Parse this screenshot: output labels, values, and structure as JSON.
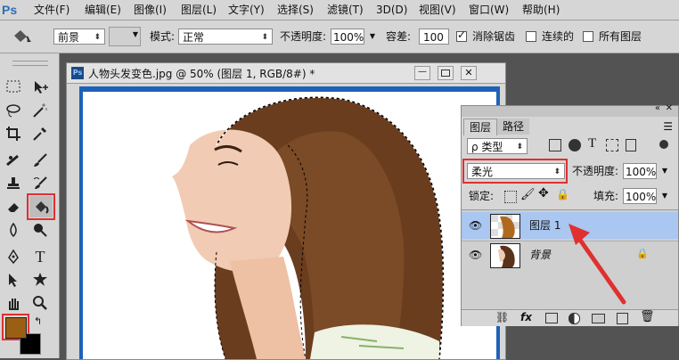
{
  "app": {
    "logo": "Ps"
  },
  "menu": [
    "文件(F)",
    "编辑(E)",
    "图像(I)",
    "图层(L)",
    "文字(Y)",
    "选择(S)",
    "滤镜(T)",
    "3D(D)",
    "视图(V)",
    "窗口(W)",
    "帮助(H)"
  ],
  "options": {
    "fill_source": "前景",
    "mode_label": "模式:",
    "mode_value": "正常",
    "opacity_label": "不透明度:",
    "opacity_value": "100%",
    "tolerance_label": "容差:",
    "tolerance_value": "100",
    "antialias_label": "消除锯齿",
    "antialias_checked": true,
    "contiguous_label": "连续的",
    "contiguous_checked": false,
    "all_layers_label": "所有图层",
    "all_layers_checked": false
  },
  "document": {
    "title": "人物头发变色.jpg @ 50% (图层 1, RGB/8#) *",
    "badge": "Ps"
  },
  "layers_panel": {
    "tabs": [
      "图层",
      "路径"
    ],
    "filter_label": "ρ 类型",
    "blend_mode": "柔光",
    "opacity_label": "不透明度:",
    "opacity_value": "100%",
    "lock_label": "锁定:",
    "fill_label": "填充:",
    "fill_value": "100%",
    "layers": [
      {
        "name": "图层 1",
        "selected": true,
        "visible": true
      },
      {
        "name": "背景",
        "selected": false,
        "visible": true,
        "locked": true
      }
    ],
    "bottom_icons": [
      "link-icon",
      "fx-icon",
      "mask-icon",
      "adjustment-icon",
      "group-icon",
      "new-layer-icon",
      "trash-icon"
    ]
  },
  "colors": {
    "foreground": "#9b5f13",
    "background": "#000000",
    "highlight": "#e03030",
    "selected_layer": "#a9c7f0"
  },
  "tools": [
    "marquee-icon",
    "move-icon",
    "lasso-icon",
    "magic-wand-icon",
    "crop-icon",
    "eyedropper-icon",
    "healing-icon",
    "brush-icon",
    "stamp-icon",
    "history-brush-icon",
    "eraser-icon",
    "paint-bucket-icon",
    "blur-icon",
    "dodge-icon",
    "pen-icon",
    "type-icon",
    "path-select-icon",
    "shape-icon",
    "hand-icon",
    "zoom-icon"
  ]
}
